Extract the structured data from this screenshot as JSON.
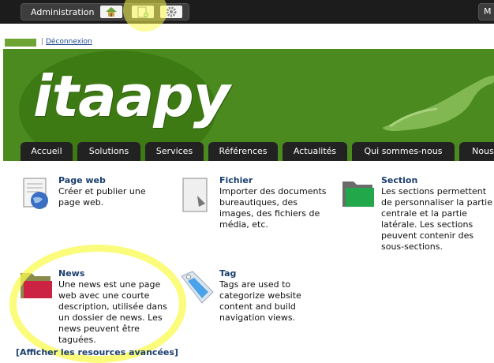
{
  "admin_bar": {
    "label": "Administration",
    "icons": [
      "home-icon",
      "new-page-icon",
      "gear-icon"
    ],
    "right_label": "M"
  },
  "banner": {
    "logout": "Déconnexion",
    "logo_text": "itaapy"
  },
  "nav": {
    "tabs": [
      "Accueil",
      "Solutions",
      "Services",
      "Références",
      "Actualités",
      "Qui sommes-nous",
      "Nous"
    ]
  },
  "resources": [
    {
      "title": "Page web",
      "desc": "Créer et publier une page web.",
      "icon": "web-page-icon"
    },
    {
      "title": "Fichier",
      "desc": "Importer des documents bureautiques, des images, des fichiers de média, etc.",
      "icon": "file-icon"
    },
    {
      "title": "Section",
      "desc": "Les sections permettent de personnaliser la partie centrale et la partie latérale. Les sections peuvent contenir des sous-sections.",
      "icon": "folder-green-icon"
    },
    {
      "title": "News",
      "desc": "Une news est une page web avec une courte description, utilisée dans un dossier de news. Les news peuvent être taguées.",
      "icon": "folder-red-icon"
    },
    {
      "title": "Tag",
      "desc": "Tags are used to categorize website content and build navigation views.",
      "icon": "tag-icon"
    }
  ],
  "advanced_link": "[Afficher les resources avancées]"
}
